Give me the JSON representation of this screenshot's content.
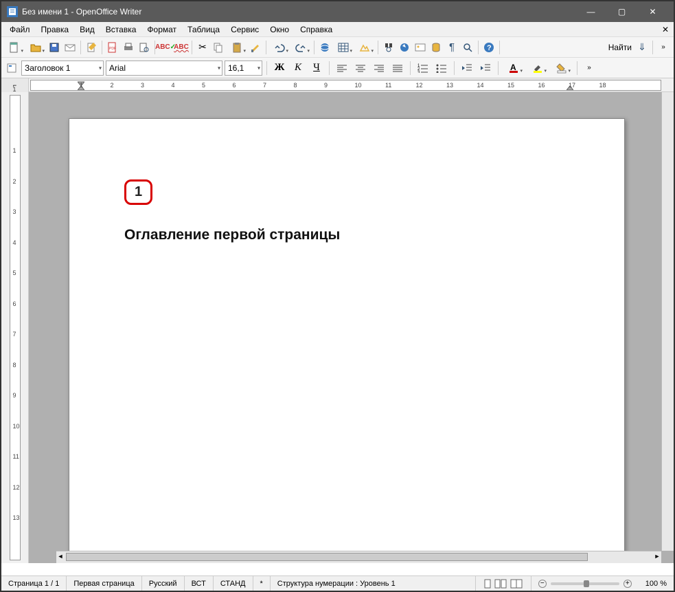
{
  "window": {
    "title": "Без имени 1 - OpenOffice Writer"
  },
  "menu": {
    "file": "Файл",
    "edit": "Правка",
    "view": "Вид",
    "insert": "Вставка",
    "format": "Формат",
    "table": "Таблица",
    "tools": "Сервис",
    "window": "Окно",
    "help": "Справка"
  },
  "formatting": {
    "style": "Заголовок 1",
    "font": "Arial",
    "size": "16,1",
    "bold_label": "Ж",
    "italic_label": "К",
    "underline_label": "Ч"
  },
  "find": {
    "label": "Найти"
  },
  "ruler": {
    "h": [
      "1",
      "",
      "1",
      "2",
      "3",
      "4",
      "5",
      "6",
      "7",
      "8",
      "9",
      "10",
      "11",
      "12",
      "13",
      "14",
      "15",
      "16",
      "17",
      "18"
    ],
    "v": [
      "1",
      "",
      "1",
      "2",
      "3",
      "4",
      "5",
      "6",
      "7",
      "8",
      "9",
      "10",
      "11",
      "12",
      "13"
    ]
  },
  "document": {
    "heading_number": "1",
    "heading_text": "Оглавление первой страницы"
  },
  "status": {
    "page": "Страница 1 / 1",
    "page_style": "Первая страница",
    "language": "Русский",
    "insert_mode": "ВСТ",
    "sel_mode": "СТАНД",
    "modified": "*",
    "outline": "Структура нумерации : Уровень 1",
    "zoom": "100 %"
  }
}
